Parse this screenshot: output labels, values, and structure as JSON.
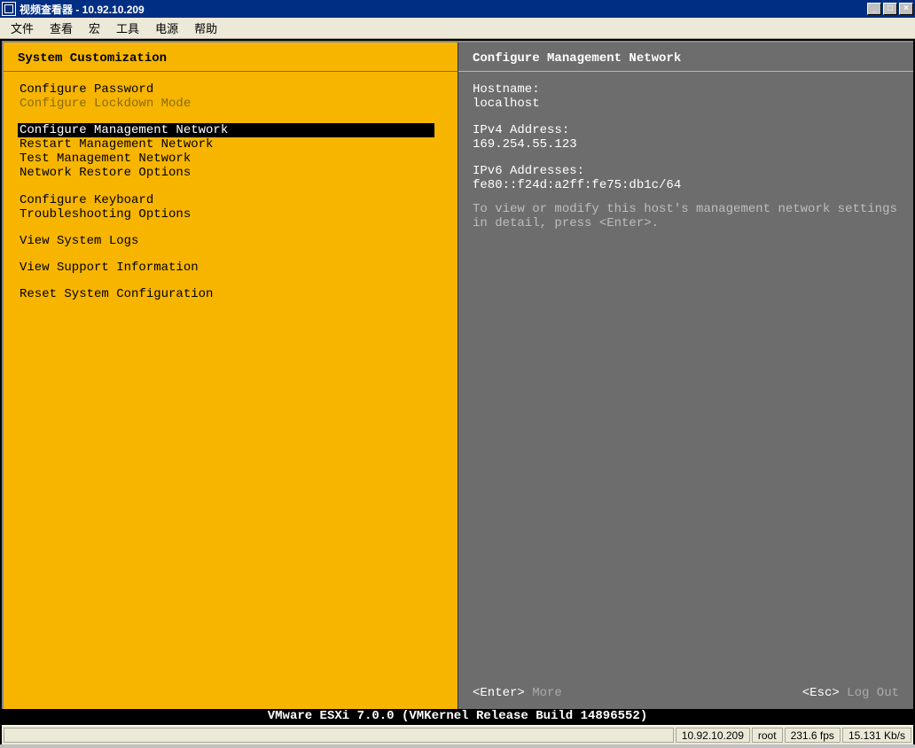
{
  "window": {
    "title": "视频查看器 - 10.92.10.209",
    "minimize": "_",
    "maximize": "□",
    "close": "×"
  },
  "menubar": {
    "items": [
      "文件",
      "查看",
      "宏",
      "工具",
      "电源",
      "帮助"
    ]
  },
  "left": {
    "title": "System Customization",
    "items": [
      {
        "label": "Configure Password",
        "disabled": false
      },
      {
        "label": "Configure Lockdown Mode",
        "disabled": true
      },
      {
        "label": "",
        "blank": true
      },
      {
        "label": "Configure Management Network",
        "selected": true
      },
      {
        "label": "Restart Management Network"
      },
      {
        "label": "Test Management Network"
      },
      {
        "label": "Network Restore Options"
      },
      {
        "label": "",
        "blank": true
      },
      {
        "label": "Configure Keyboard"
      },
      {
        "label": "Troubleshooting Options"
      },
      {
        "label": "",
        "blank": true
      },
      {
        "label": "View System Logs"
      },
      {
        "label": "",
        "blank": true
      },
      {
        "label": "View Support Information"
      },
      {
        "label": "",
        "blank": true
      },
      {
        "label": "Reset System Configuration"
      }
    ]
  },
  "right": {
    "title": "Configure Management Network",
    "hostname_label": "Hostname:",
    "hostname_value": "localhost",
    "ipv4_label": "IPv4 Address:",
    "ipv4_value": "169.254.55.123",
    "ipv6_label": "IPv6 Addresses:",
    "ipv6_value": "fe80::f24d:a2ff:fe75:db1c/64",
    "help_text": "To view or modify this host's management network settings in detail, press <Enter>."
  },
  "footer": {
    "enter_key": "<Enter>",
    "enter_label": " More",
    "esc_key": "<Esc>",
    "esc_label": " Log Out"
  },
  "version": "VMware ESXi 7.0.0 (VMKernel Release Build 14896552)",
  "status": {
    "ip": "10.92.10.209",
    "user": "root",
    "fps": "231.6 fps",
    "bw": "15.131 Kb/s"
  }
}
